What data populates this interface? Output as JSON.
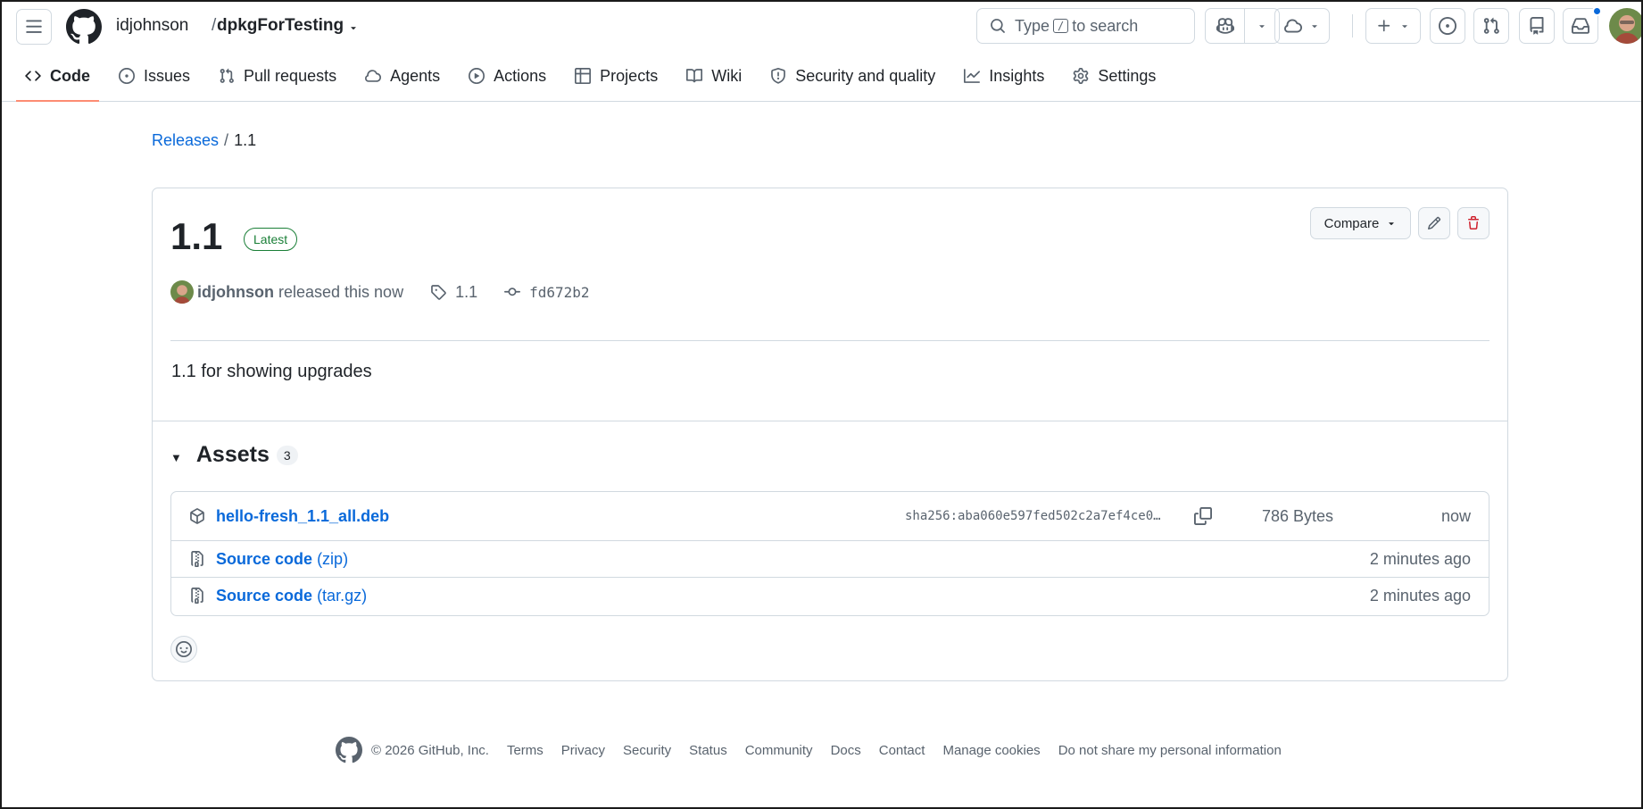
{
  "header": {
    "owner": "idjohnson",
    "separator": "/",
    "repo": "dpkgForTesting",
    "search_placeholder_pre": "Type",
    "search_key": "/",
    "search_placeholder_post": "to search"
  },
  "tabs": [
    {
      "label": "Code",
      "icon": "code-icon",
      "selected": true
    },
    {
      "label": "Issues",
      "icon": "issue-opened-icon"
    },
    {
      "label": "Pull requests",
      "icon": "git-pull-request-icon"
    },
    {
      "label": "Agents",
      "icon": "agent-icon"
    },
    {
      "label": "Actions",
      "icon": "play-icon"
    },
    {
      "label": "Projects",
      "icon": "table-icon"
    },
    {
      "label": "Wiki",
      "icon": "book-icon"
    },
    {
      "label": "Security and quality",
      "icon": "shield-icon"
    },
    {
      "label": "Insights",
      "icon": "graph-icon"
    },
    {
      "label": "Settings",
      "icon": "gear-icon"
    }
  ],
  "breadcrumb": {
    "releases": "Releases",
    "sep": "/",
    "current": "1.1"
  },
  "release": {
    "title": "1.1",
    "badge": "Latest",
    "compare_label": "Compare",
    "author": "idjohnson",
    "released_text": "released this now",
    "tag": "1.1",
    "commit": "fd672b2",
    "body": "1.1 for showing upgrades"
  },
  "assets": {
    "title": "Assets",
    "count": "3",
    "items": [
      {
        "name": "hello-fresh_1.1_all.deb",
        "ext": "",
        "sha": "sha256:aba060e597fed502c2a7ef4ce0…",
        "size": "786 Bytes",
        "time": "now"
      },
      {
        "name": "Source code",
        "ext": "(zip)",
        "time": "2 minutes ago"
      },
      {
        "name": "Source code",
        "ext": "(tar.gz)",
        "time": "2 minutes ago"
      }
    ]
  },
  "footer": {
    "copyright": "© 2026 GitHub, Inc.",
    "links": [
      "Terms",
      "Privacy",
      "Security",
      "Status",
      "Community",
      "Docs",
      "Contact",
      "Manage cookies",
      "Do not share my personal information"
    ]
  },
  "colors": {
    "link": "#0969da",
    "latest": "#1a7f37",
    "danger": "#cf222e",
    "selected_tab": "#fd8c73"
  }
}
